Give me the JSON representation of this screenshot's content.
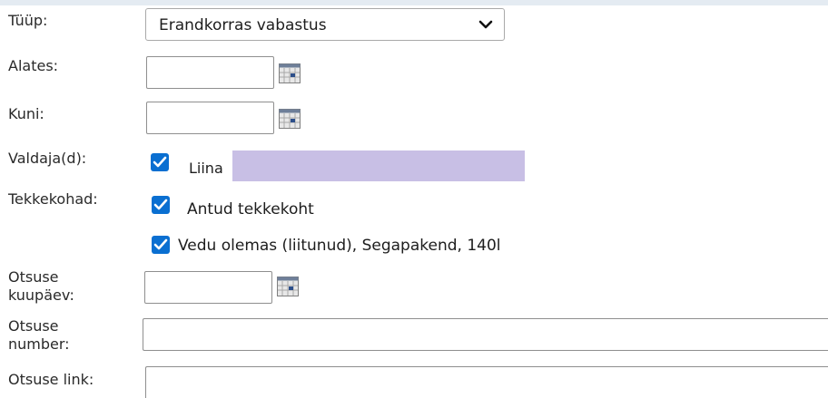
{
  "form": {
    "type_label": "Tüüp:",
    "type_value": "Erandkorras vabastus",
    "from_label": "Alates:",
    "to_label": "Kuni:",
    "owners_label": "Valdaja(d):",
    "owner_name": "Liina",
    "locations_label": "Tekkekohad:",
    "location_option_1": "Antud tekkekoht",
    "location_option_2": "Vedu olemas (liitunud), Segapakend, 140l",
    "decision_date_label_1": "Otsuse",
    "decision_date_label_2": "kuupäev:",
    "decision_number_label_1": "Otsuse",
    "decision_number_label_2": "number:",
    "decision_link_label": "Otsuse link:"
  },
  "icons": {
    "select_arrow": "chevron-down-icon",
    "date_picker": "calendar-icon",
    "checkbox": "checkmark-icon"
  },
  "colors": {
    "checkbox_checked": "#0a6fd1",
    "redaction": "#c8bfe5"
  }
}
